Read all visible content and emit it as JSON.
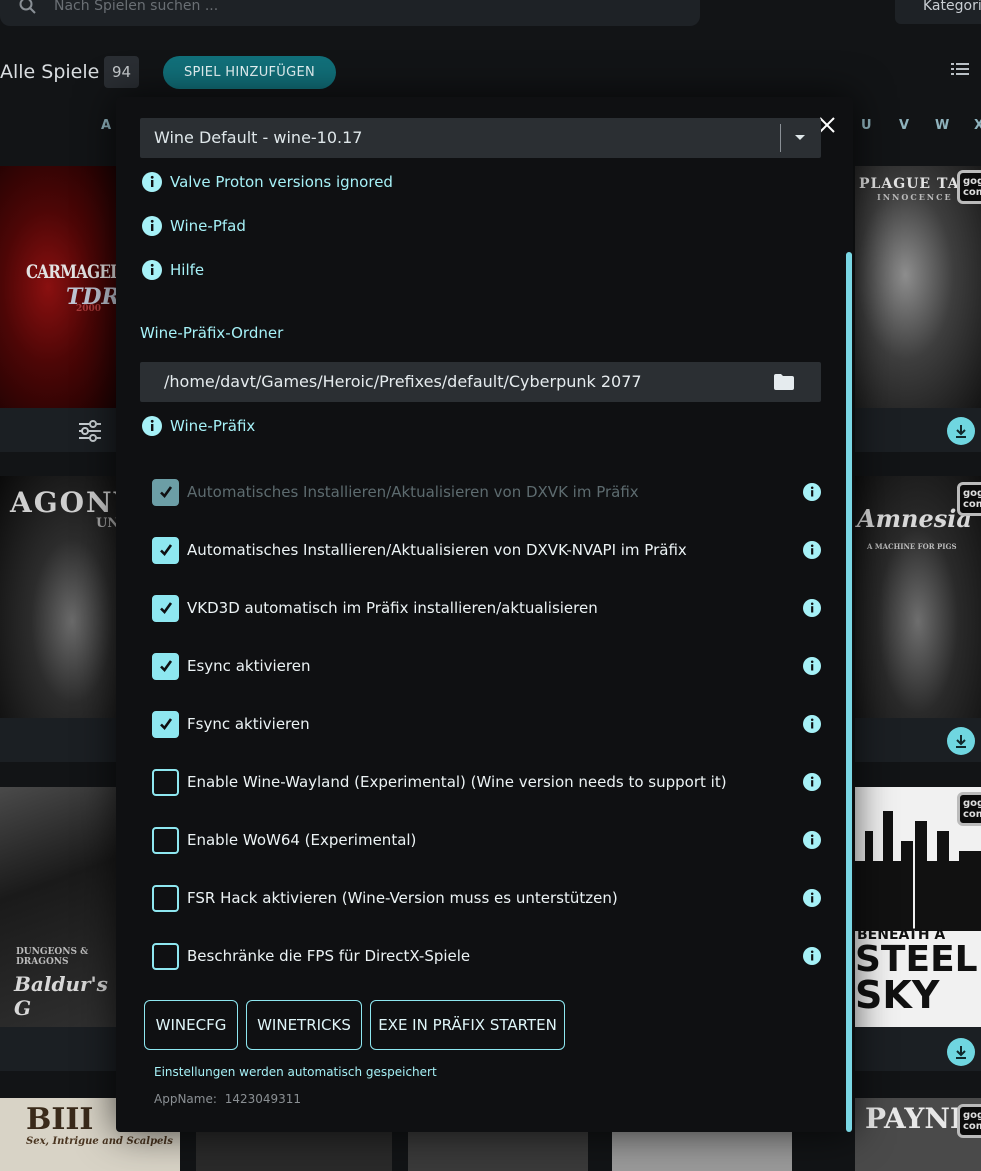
{
  "search": {
    "placeholder": "Nach Spielen suchen ..."
  },
  "category_button": "Kategorie",
  "library": {
    "title": "Alle Spiele",
    "count": "94",
    "add_game_label": "SPIEL HINZUFÜGEN",
    "letters_left": [
      "A"
    ],
    "letters_right": [
      "U",
      "V",
      "W",
      "X"
    ]
  },
  "cover_texts": {
    "carmageddon": "CARMAGEDDON",
    "tdr": "TDR",
    "tdr_year": "2000",
    "plague_tale": "PLAGUE TA",
    "plague_sub": "INNOCENCE",
    "agony": "AGONY",
    "agony_sub": "UN",
    "amnesia": "Amnesia",
    "amnesia_sub": "A MACHINE FOR PIGS",
    "baldurs": "Baldur's G",
    "dungeons": "DUNGEONS & DRAGONS",
    "beneath": "BENEATH A",
    "steel": "STEEL",
    "sky": "SKY",
    "bill": "BIII",
    "bill_sub": "Sex, Intrigue and Scalpels",
    "payne": "PAYNE",
    "gog": "gog com"
  },
  "modal": {
    "wine_version": "Wine Default - wine-10.17",
    "info_proton": "Valve Proton versions ignored",
    "info_wine_path": "Wine-Pfad",
    "info_help": "Hilfe",
    "prefix_folder_label": "Wine-Präfix-Ordner",
    "prefix_path": "/home/davt/Games/Heroic/Prefixes/default/Cyberpunk 2077",
    "info_prefix": "Wine-Präfix",
    "options": [
      {
        "label": "Automatisches Installieren/Aktualisieren von DXVK im Präfix",
        "checked": true,
        "disabled": true
      },
      {
        "label": "Automatisches Installieren/Aktualisieren von DXVK-NVAPI im Präfix",
        "checked": true,
        "disabled": false
      },
      {
        "label": "VKD3D automatisch im Präfix installieren/aktualisieren",
        "checked": true,
        "disabled": false
      },
      {
        "label": "Esync aktivieren",
        "checked": true,
        "disabled": false
      },
      {
        "label": "Fsync aktivieren",
        "checked": true,
        "disabled": false
      },
      {
        "label": "Enable Wine-Wayland (Experimental) (Wine version needs to support it)",
        "checked": false,
        "disabled": false
      },
      {
        "label": "Enable WoW64 (Experimental)",
        "checked": false,
        "disabled": false
      },
      {
        "label": "FSR Hack aktivieren (Wine-Version muss es unterstützen)",
        "checked": false,
        "disabled": false
      },
      {
        "label": "Beschränke die FPS für DirectX-Spiele",
        "checked": false,
        "disabled": false
      }
    ],
    "buttons": {
      "winecfg": "WINECFG",
      "winetricks": "WINETRICKS",
      "run_exe": "EXE IN PRÄFIX STARTEN"
    },
    "autosave_note": "Einstellungen werden automatisch gespeichert",
    "appname_label": "AppName:",
    "appname_value": "1423049311"
  },
  "colors": {
    "accent": "#8ee7f0",
    "info_text": "#a6f1f7",
    "add_button": "#11707a"
  }
}
